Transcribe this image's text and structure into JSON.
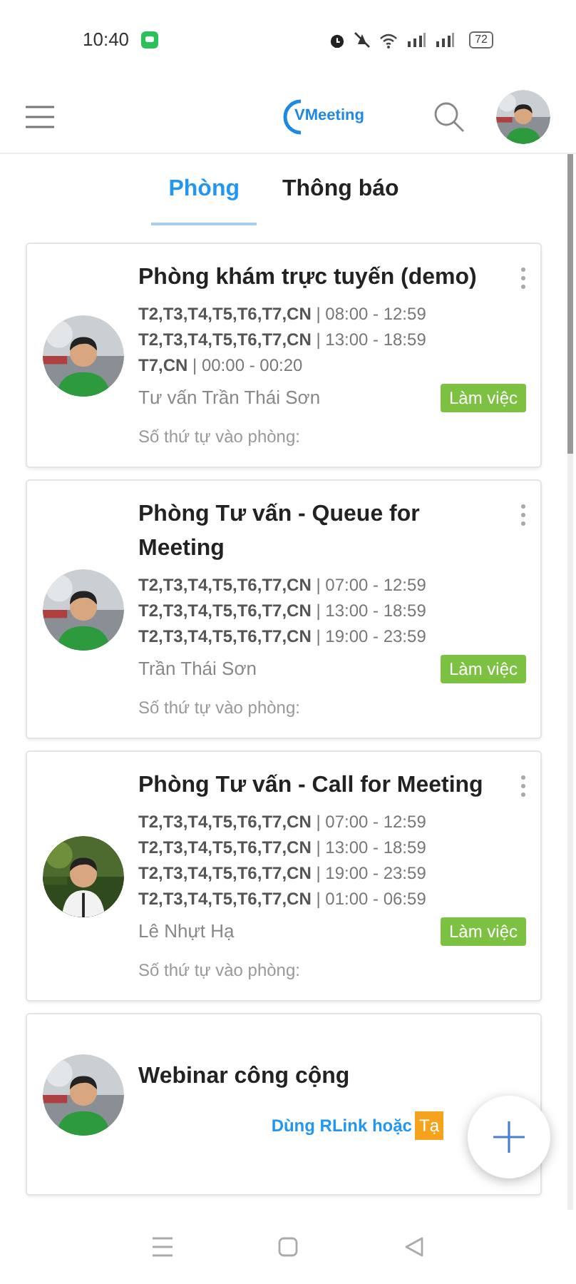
{
  "status_bar": {
    "time": "10:40",
    "battery": "72"
  },
  "app_bar": {
    "logo": "VMeeting"
  },
  "tabs": [
    {
      "label": "Phòng",
      "selected": true
    },
    {
      "label": "Thông báo",
      "selected": false
    }
  ],
  "rooms": [
    {
      "title": "Phòng khám trực tuyến (demo)",
      "schedule": [
        "**T2,T3,T4,T5,T6,T7,CN** | 08:00 - 12:59",
        "**T2,T3,T4,T5,T6,T7,CN** | 13:00 - 18:59",
        "**T7,CN** | 00:00 - 00:20"
      ],
      "host": "Tư vấn Trần Thái Sơn",
      "status": "Làm việc",
      "queue": "Số thứ tự vào phòng:"
    },
    {
      "title": "Phòng Tư vấn - Queue for Meeting",
      "schedule": [
        "**T2,T3,T4,T5,T6,T7,CN** | 07:00 - 12:59",
        "**T2,T3,T4,T5,T6,T7,CN** | 13:00 - 18:59",
        "**T2,T3,T4,T5,T6,T7,CN** | 19:00 - 23:59"
      ],
      "host": "Trần Thái Sơn",
      "status": "Làm việc",
      "queue": "Số thứ tự vào phòng:"
    },
    {
      "title": "Phòng Tư vấn - Call for Meeting",
      "schedule": [
        "**T2,T3,T4,T5,T6,T7,CN** | 07:00 - 12:59",
        "**T2,T3,T4,T5,T6,T7,CN** | 13:00 - 18:59",
        "**T2,T3,T4,T5,T6,T7,CN** | 19:00 - 23:59",
        "**T2,T3,T4,T5,T6,T7,CN** | 01:00 - 06:59"
      ],
      "host": "Lê Nhựt Hạ",
      "status": "Làm việc",
      "queue": "Số thứ tự vào phòng:"
    },
    {
      "title": "Webinar công cộng",
      "link": "Dùng RLink hoặc",
      "badge": "Tạ"
    }
  ]
}
